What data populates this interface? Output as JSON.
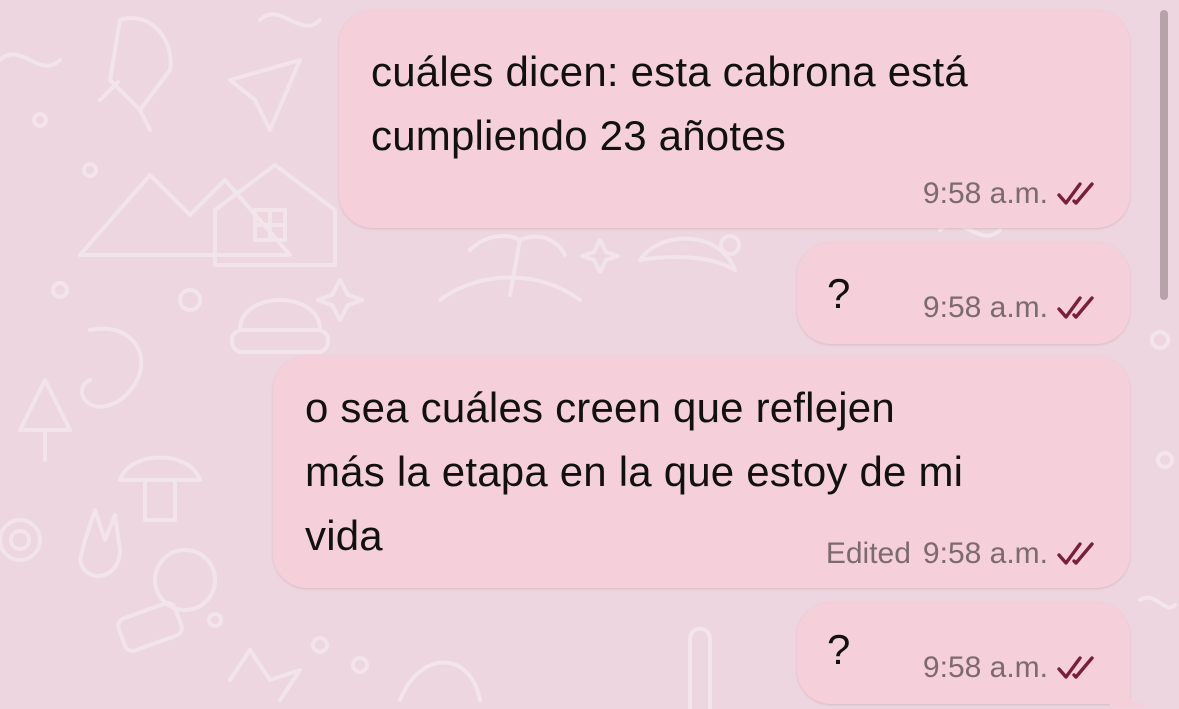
{
  "chat": {
    "messages": [
      {
        "text": "cuáles dicen: esta cabrona está\ncumpliendo 23 añotes",
        "time": "9:58 a.m.",
        "status": "read",
        "edited_label": ""
      },
      {
        "text": "?",
        "time": "9:58 a.m.",
        "status": "read",
        "edited_label": ""
      },
      {
        "text": "o sea cuáles creen que reflejen\nmás la etapa en la que estoy de mi\nvida",
        "time": "9:58 a.m.",
        "status": "read",
        "edited_label": "Edited"
      },
      {
        "text": "?",
        "time": "9:58 a.m.",
        "status": "read",
        "edited_label": ""
      }
    ]
  },
  "colors": {
    "background": "#edd6df",
    "bubble": "#f5d0db",
    "text": "#111111",
    "meta": "#7d6a70",
    "read_ticks": "#7a1f3a"
  },
  "icons": {
    "read_receipt": "double-check-icon",
    "wallpaper": "doodle-pattern"
  }
}
